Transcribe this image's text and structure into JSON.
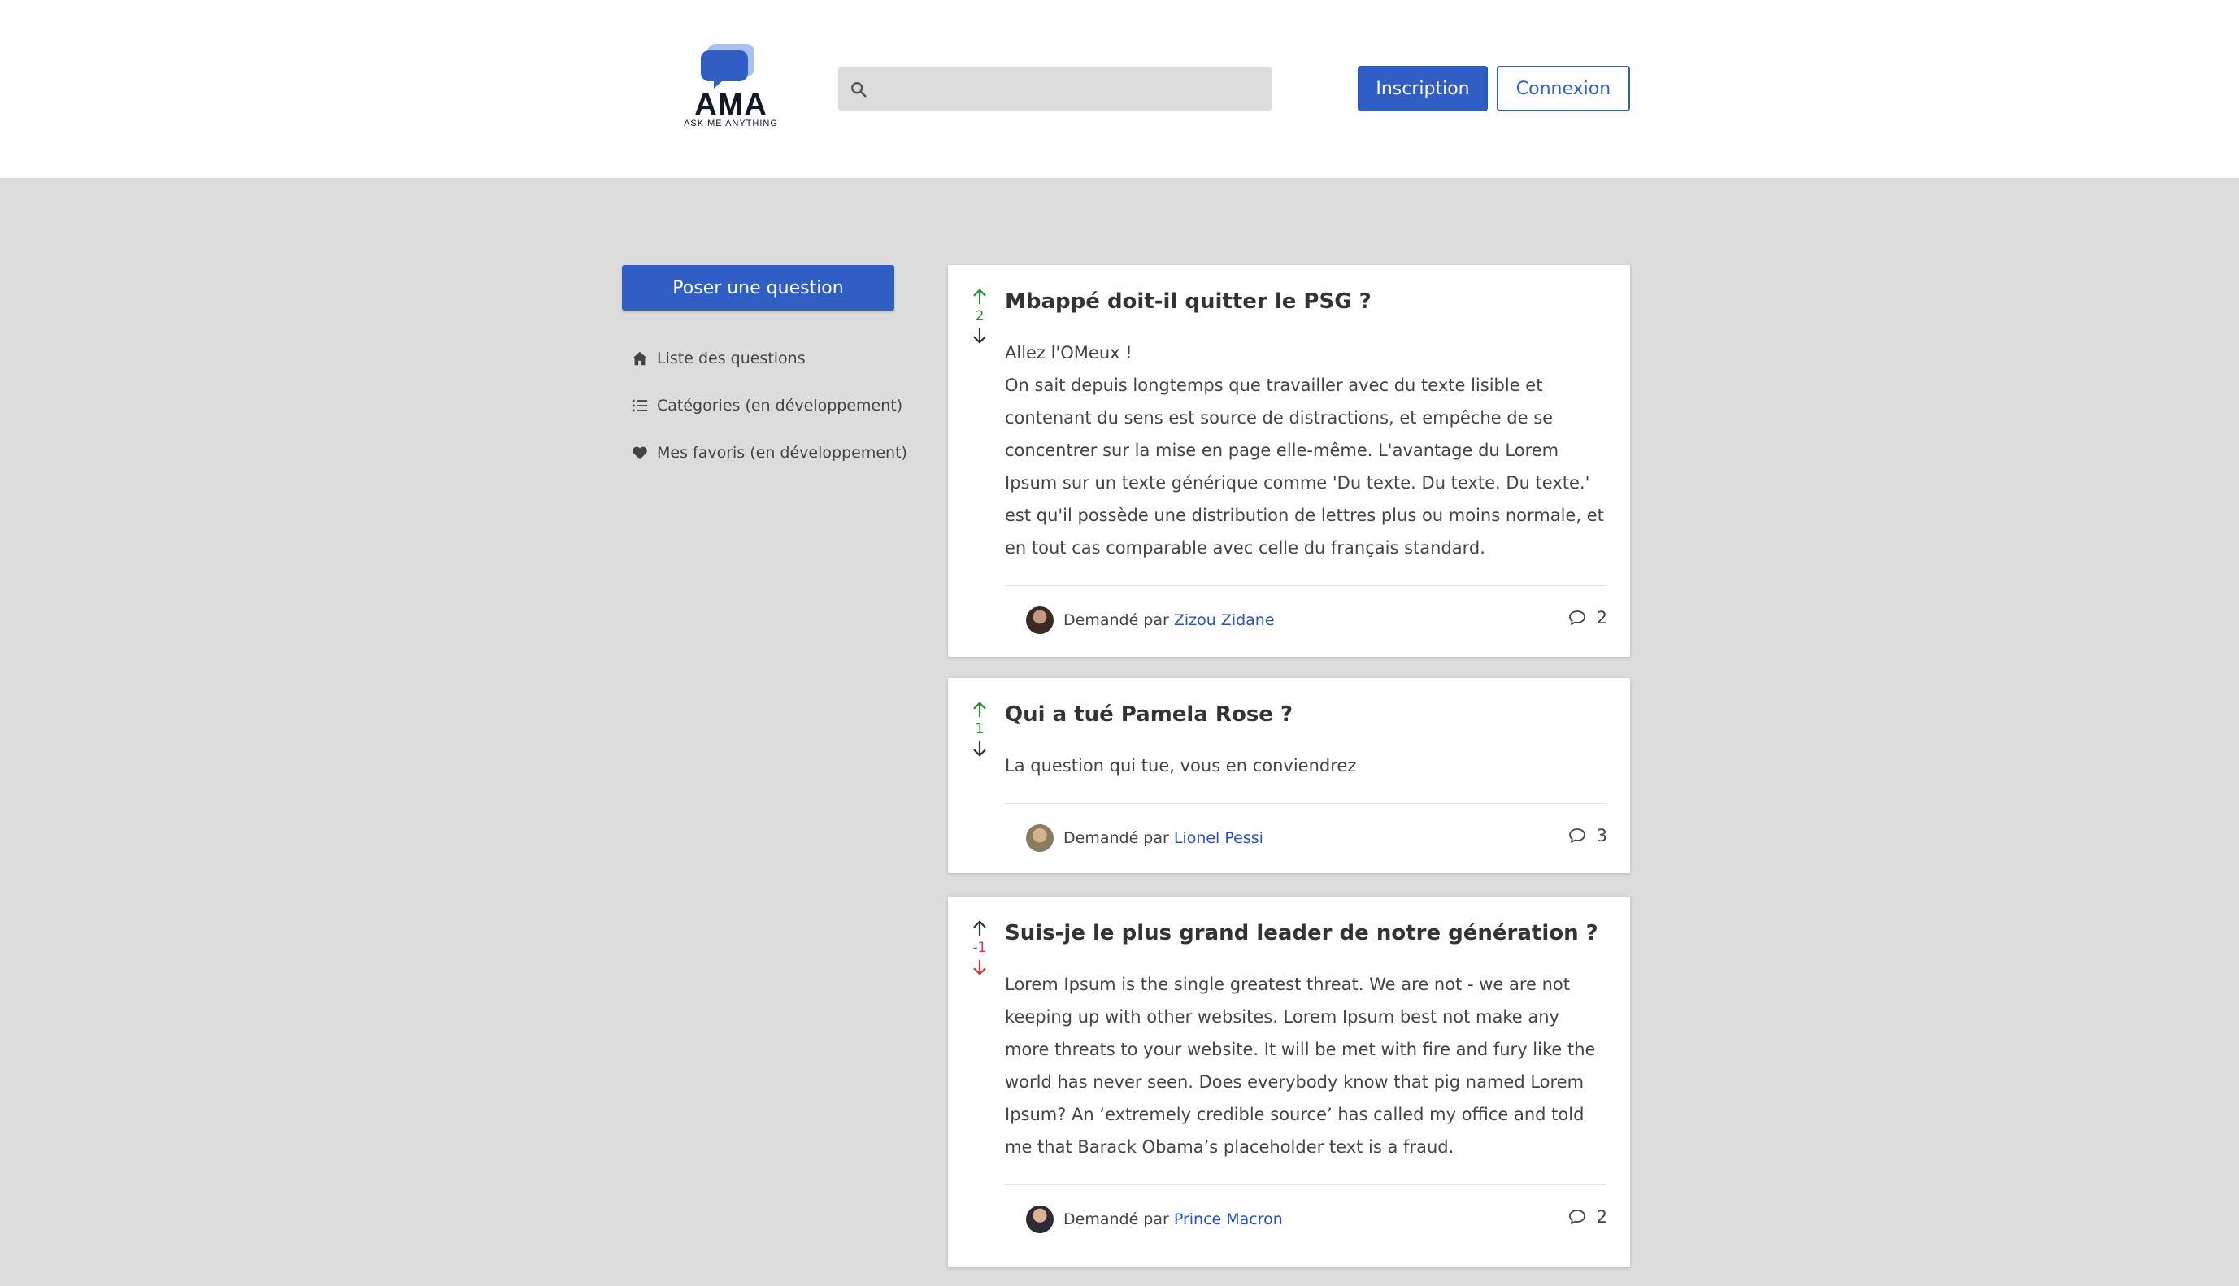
{
  "header": {
    "logo_text": "AMA",
    "logo_tagline": "ASK ME ANYTHING",
    "search_placeholder": "",
    "signup_label": "Inscription",
    "login_label": "Connexion"
  },
  "sidebar": {
    "ask_label": "Poser une question",
    "items": [
      {
        "label": "Liste des questions",
        "icon": "home-icon"
      },
      {
        "label": "Catégories (en développement)",
        "icon": "list-icon"
      },
      {
        "label": "Mes favoris (en développement)",
        "icon": "heart-icon"
      }
    ]
  },
  "colors": {
    "accent": "#2f5ec4",
    "vote_positive": "#2e8b3a",
    "vote_negative": "#d23b3b",
    "background": "#dcdcdc"
  },
  "questions": [
    {
      "score": "2",
      "title": "Mbappé doit-il quitter le PSG ?",
      "body": "Allez l'OMeux !\nOn sait depuis longtemps que travailler avec du texte lisible et contenant du sens est source de distractions, et empêche de se concentrer sur la mise en page elle-même. L'avantage du Lorem Ipsum sur un texte générique comme 'Du texte. Du texte. Du texte.' est qu'il possède une distribution de lettres plus ou moins normale, et en tout cas comparable avec celle du français standard.",
      "asked_by": "Demandé par",
      "author": "Zizou Zidane",
      "comments": "2"
    },
    {
      "score": "1",
      "title": "Qui a tué Pamela Rose ?",
      "body": "La question qui tue, vous en conviendrez",
      "asked_by": "Demandé par",
      "author": "Lionel Pessi",
      "comments": "3"
    },
    {
      "score": "-1",
      "title": "Suis-je le plus grand leader de notre génération ?",
      "body": "Lorem Ipsum is the single greatest threat. We are not - we are not keeping up with other websites. Lorem Ipsum best not make any more threats to your website. It will be met with fire and fury like the world has never seen. Does everybody know that pig named Lorem Ipsum? An ‘extremely credible source’ has called my office and told me that Barack Obama’s placeholder text is a fraud.",
      "asked_by": "Demandé par",
      "author": "Prince Macron",
      "comments": "2"
    }
  ]
}
